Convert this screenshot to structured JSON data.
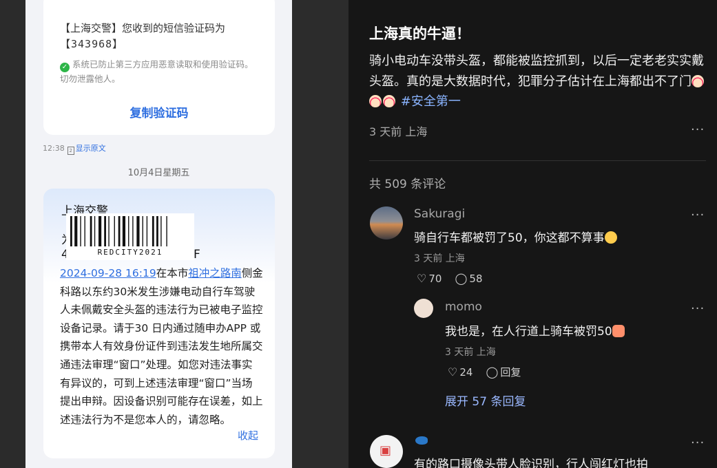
{
  "left": {
    "sms1": {
      "text": "【上海交警】您收到的短信验证码为",
      "code": "【343968】",
      "secure_note": "系统已防止第三方应用恶意读取和使用验证码。切勿泄露他人。",
      "copy_label": "复制验证码"
    },
    "time_row": {
      "time": "12:38",
      "box": "2",
      "show_original": "显示原文"
    },
    "date_separator": "10月4日星期五",
    "sms2": {
      "title": "上海交警",
      "partial_line_start": "为",
      "partial_line_prefix": "4",
      "partial_line_suffix": "F",
      "watermark": "REDCITY2021",
      "datetime_link": "2024-09-28 16:19",
      "in_city": "在本市",
      "road_link": "祖冲之路南",
      "body": "侧金科路以东约30米发生涉嫌电动自行车驾驶人未佩戴安全头盔的违法行为已被电子监控设备记录。请于30 日内通过随申办APP 或携带本人有效身份证件到违法发生地所属交通违法审理“窗口”处理。如您对违法事实有异议的，可到上述违法审理“窗口”当场提出申辩。因设备识别可能存在误差，如上述违法行为不是您本人的，请忽略。",
      "collapse_label": "收起"
    }
  },
  "post": {
    "title": "上海真的牛逼！",
    "body": "骑小电动车没带头盔，都能被监控抓到，以后一定老老实实戴头盔。真的是大数据时代，犯罪分子估计在上海都出不了门",
    "tag": "#安全第一",
    "meta": "3 天前 上海",
    "more": "···",
    "comment_count": "共 509 条评论",
    "comments": [
      {
        "name": "Sakuragi",
        "text": "骑自行车都被罚了50，你这都不算事",
        "meta": "3 天前 上海",
        "likes": "70",
        "replies": "58"
      },
      {
        "name": "momo",
        "text": "我也是，在人行道上骑车被罚50",
        "meta": "3 天前 上海",
        "likes": "24",
        "reply_label": "回复"
      },
      {
        "text": "有的路口摄像头带人脸识别，行人闯红灯也拍"
      }
    ],
    "expand_label": "展开 57 条回复"
  },
  "icons": {
    "shield": "shield-check-icon",
    "heart": "heart-icon",
    "comment": "comment-bubble-icon",
    "more": "more-dots-icon",
    "gift": "gift-icon"
  },
  "colors": {
    "link": "#2f6fe0",
    "tag": "#8ab4ff",
    "post_bg": "#161616"
  }
}
